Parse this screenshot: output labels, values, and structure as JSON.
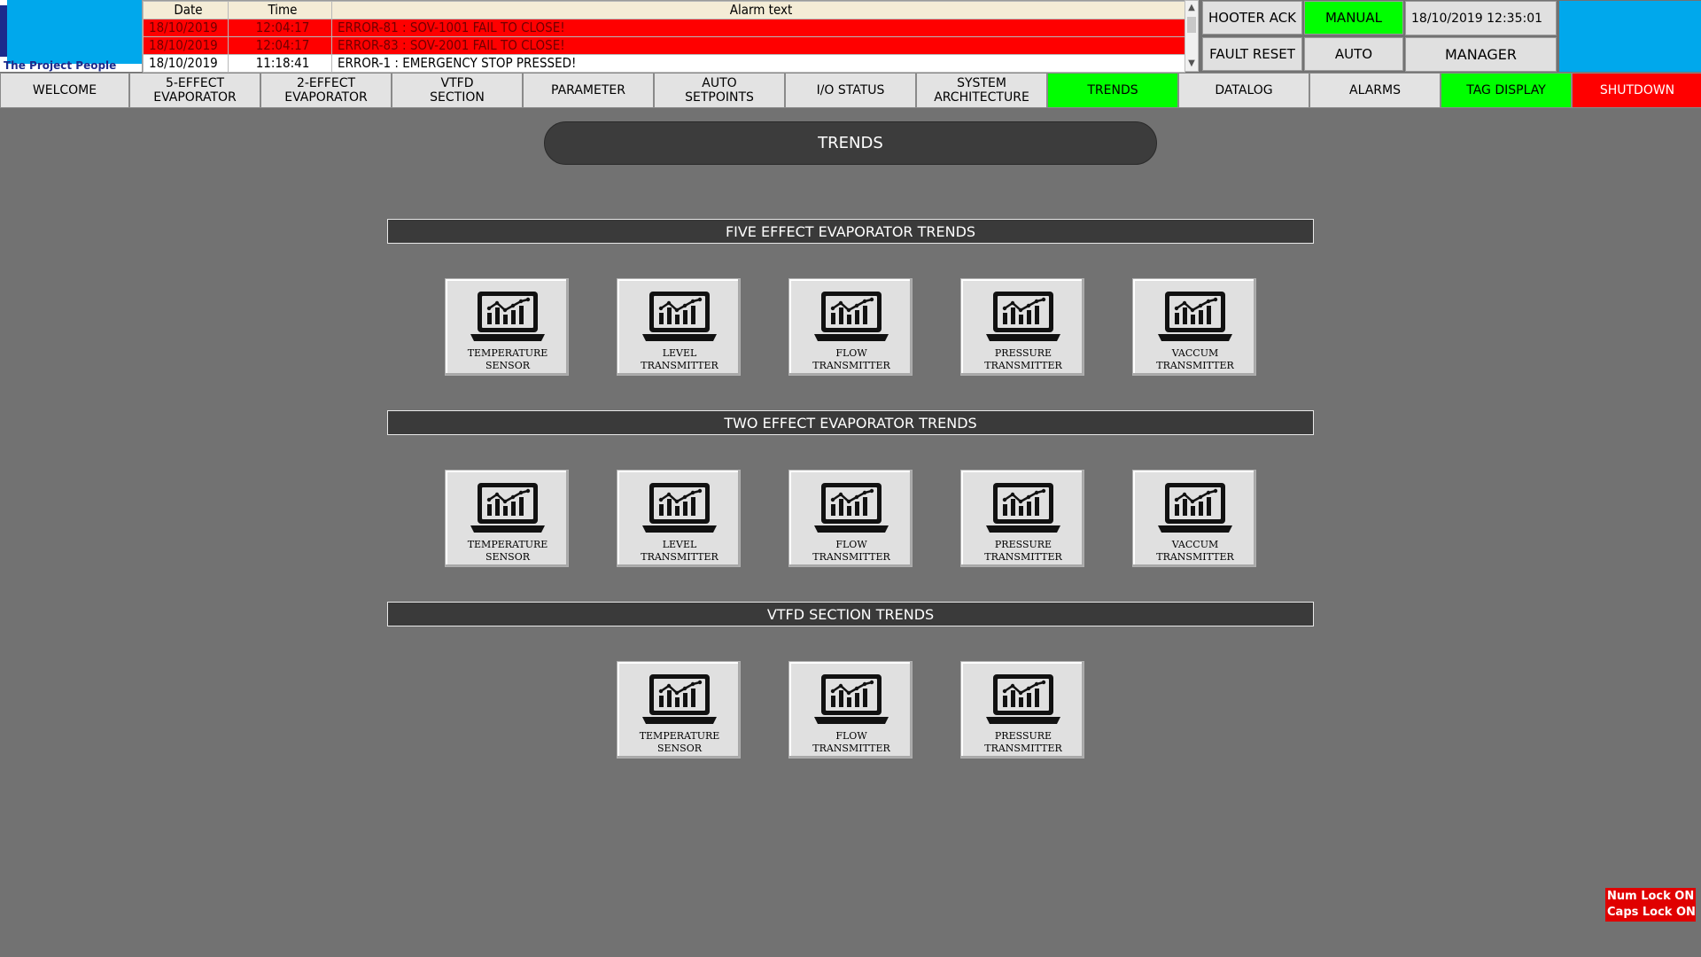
{
  "logo": {
    "tagline": "The Project  People",
    "brand_color": "#00a8ec"
  },
  "alarm_panel": {
    "columns": [
      "Date",
      "Time",
      "Alarm text"
    ],
    "rows": [
      {
        "date": "18/10/2019",
        "time": "12:04:17",
        "text": "ERROR-81 : SOV-1001 FAIL TO CLOSE!",
        "active": true
      },
      {
        "date": "18/10/2019",
        "time": "12:04:17",
        "text": "ERROR-83 : SOV-2001 FAIL TO CLOSE!",
        "active": true
      },
      {
        "date": "18/10/2019",
        "time": "11:18:41",
        "text": "ERROR-1 : EMERGENCY STOP PRESSED!",
        "active": false
      }
    ]
  },
  "top_controls": {
    "hooter_ack": "HOOTER ACK",
    "fault_reset": "FAULT RESET",
    "manual": "MANUAL",
    "auto": "AUTO",
    "datetime": "18/10/2019 12:35:01",
    "user_level": "MANAGER"
  },
  "nav": [
    {
      "label": "WELCOME",
      "active": false
    },
    {
      "label": "5-EFFECT\nEVAPORATOR",
      "active": false
    },
    {
      "label": "2-EFFECT\nEVAPORATOR",
      "active": false
    },
    {
      "label": "VTFD\nSECTION",
      "active": false
    },
    {
      "label": "PARAMETER",
      "active": false
    },
    {
      "label": "AUTO\nSETPOINTS",
      "active": false
    },
    {
      "label": "I/O STATUS",
      "active": false
    },
    {
      "label": "SYSTEM\nARCHITECTURE",
      "active": false
    },
    {
      "label": "TRENDS",
      "active": true,
      "color": "#00ff00"
    },
    {
      "label": "DATALOG",
      "active": false
    },
    {
      "label": "ALARMS",
      "active": false
    },
    {
      "label": "TAG DISPLAY",
      "active": false,
      "color": "#00ff00"
    },
    {
      "label": "SHUTDOWN",
      "active": false,
      "color": "#ff0000"
    }
  ],
  "page": {
    "title": "TRENDS"
  },
  "sections": [
    {
      "title": "FIVE EFFECT EVAPORATOR TRENDS",
      "tiles": [
        {
          "label": "TEMPERATURE\nSENSOR",
          "icon": "laptop-chart-icon"
        },
        {
          "label": "LEVEL\nTRANSMITTER",
          "icon": "laptop-chart-icon"
        },
        {
          "label": "FLOW\nTRANSMITTER",
          "icon": "laptop-chart-icon"
        },
        {
          "label": "PRESSURE\nTRANSMITTER",
          "icon": "laptop-chart-icon"
        },
        {
          "label": "VACCUM\nTRANSMITTER",
          "icon": "laptop-chart-icon"
        }
      ]
    },
    {
      "title": "TWO EFFECT EVAPORATOR TRENDS",
      "tiles": [
        {
          "label": "TEMPERATURE\nSENSOR",
          "icon": "laptop-chart-icon"
        },
        {
          "label": "LEVEL\nTRANSMITTER",
          "icon": "laptop-chart-icon"
        },
        {
          "label": "FLOW\nTRANSMITTER",
          "icon": "laptop-chart-icon"
        },
        {
          "label": "PRESSURE\nTRANSMITTER",
          "icon": "laptop-chart-icon"
        },
        {
          "label": "VACCUM\nTRANSMITTER",
          "icon": "laptop-chart-icon"
        }
      ]
    },
    {
      "title": "VTFD SECTION TRENDS",
      "tiles": [
        {
          "label": "TEMPERATURE\nSENSOR",
          "icon": "laptop-chart-icon"
        },
        {
          "label": "FLOW\nTRANSMITTER",
          "icon": "laptop-chart-icon"
        },
        {
          "label": "PRESSURE\nTRANSMITTER",
          "icon": "laptop-chart-icon"
        }
      ]
    }
  ],
  "status": {
    "num_lock": "Num Lock ON",
    "caps_lock": "Caps Lock ON"
  }
}
